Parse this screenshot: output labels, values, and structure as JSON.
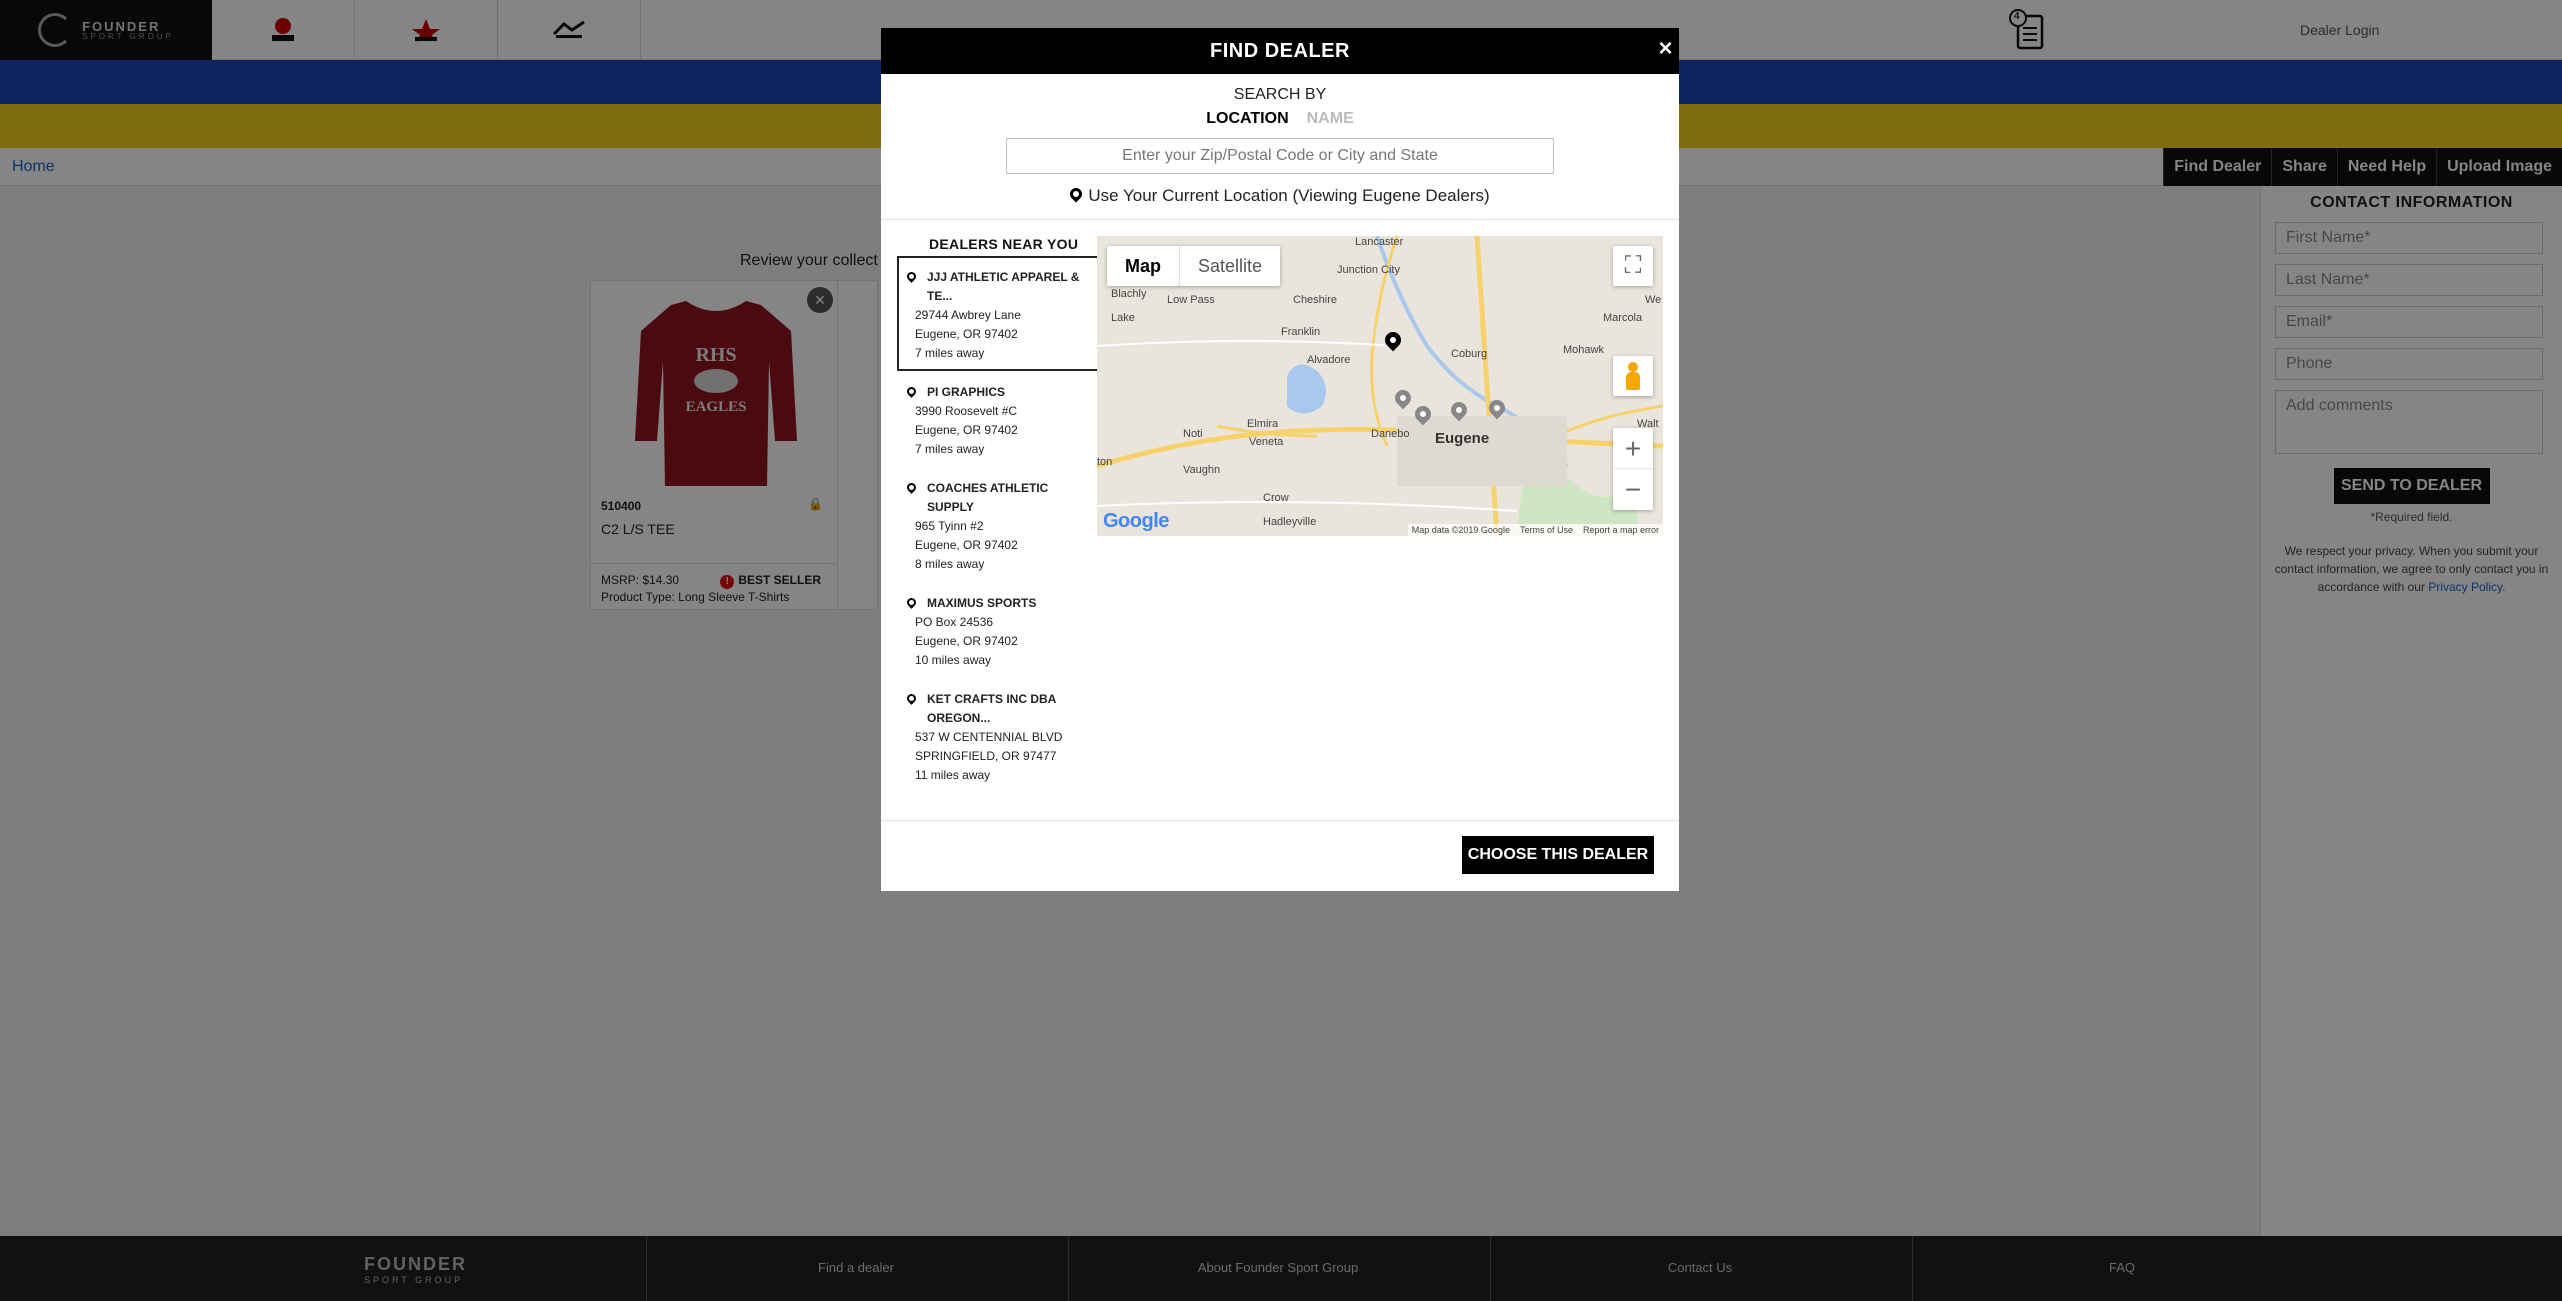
{
  "header": {
    "logo_text": "FOUNDER",
    "logo_sub": "SPORT GROUP",
    "brands": [
      {
        "name": "badger-logo"
      },
      {
        "name": "alleson-logo"
      },
      {
        "name": "garb-logo"
      }
    ],
    "cart_count": "4",
    "dealer_login": "Dealer Login"
  },
  "breadcrumb": {
    "home": "Home"
  },
  "actions": {
    "find_dealer": "Find Dealer",
    "share": "Share",
    "need_help": "Need Help",
    "upload_image": "Upload Image"
  },
  "contact": {
    "title": "CONTACT INFORMATION",
    "first_name": "First Name*",
    "last_name": "Last Name*",
    "email": "Email*",
    "phone": "Phone",
    "comments": "Add comments",
    "send": "SEND TO DEALER",
    "required": "*Required field.",
    "privacy_text": "We respect your privacy. When you submit your contact information, we agree to only contact you in accordance with our",
    "privacy_link": "Privacy Policy."
  },
  "collection": {
    "review_text": "Review your collect",
    "product": {
      "sku": "510400",
      "name": "C2 L/S TEE",
      "msrp": "MSRP: $14.30",
      "badge": "BEST SELLER",
      "type": "Product Type: Long Sleeve T-Shirts",
      "shirt_text_1": "RHS",
      "shirt_text_2": "EAGLES"
    }
  },
  "modal": {
    "title": "FIND DEALER",
    "close": "×",
    "search_by": "SEARCH BY",
    "tab_location": "LOCATION",
    "tab_name": "NAME",
    "search_placeholder": "Enter your Zip/Postal Code or City and State",
    "use_location": "Use Your Current Location (Viewing Eugene Dealers)",
    "dealers_title": "DEALERS NEAR YOU",
    "dealers": [
      {
        "name": "JJJ ATHLETIC APPAREL & TE...",
        "address": "29744 Awbrey Lane",
        "city": "Eugene, OR 97402",
        "distance": "7 miles away"
      },
      {
        "name": "PI GRAPHICS",
        "address": "3990 Roosevelt #C",
        "city": "Eugene, OR 97402",
        "distance": "7 miles away"
      },
      {
        "name": "COACHES ATHLETIC SUPPLY",
        "address": "965 Tyinn #2",
        "city": "Eugene, OR 97402",
        "distance": "8 miles away"
      },
      {
        "name": "MAXIMUS SPORTS",
        "address": "PO Box 24536",
        "city": "Eugene, OR 97402",
        "distance": "10 miles away"
      },
      {
        "name": "KET CRAFTS INC DBA OREGON...",
        "address": "537 W CENTENNIAL BLVD",
        "city": "SPRINGFIELD, OR 97477",
        "distance": "11 miles away"
      }
    ],
    "map": {
      "type_map": "Map",
      "type_satellite": "Satellite",
      "google": "Google",
      "attrib_data": "Map data ©2019 Google",
      "attrib_terms": "Terms of Use",
      "attrib_report": "Report a map error",
      "labels": [
        "Lancaster",
        "Junction City",
        "Blachly",
        "Low Pass",
        "Cheshire",
        "Franklin",
        "Alvadore",
        "Coburg",
        "Mohawk",
        "Marcola",
        "Lake",
        "Elmira",
        "Veneta",
        "Noti",
        "Danebo",
        "Eugene",
        "Vaughn",
        "Crow",
        "Hadleyville",
        "Walt",
        "We",
        "ton"
      ],
      "colors": {
        "land": "#e9e5dc",
        "water": "#a8c8ee",
        "park": "#cfe6c4",
        "highway": "#f7d26b",
        "pin_selected": "#000000",
        "pin_other": "#888888"
      }
    },
    "choose": "CHOOSE THIS DEALER"
  },
  "footer": {
    "logo": "FOUNDER",
    "logo_sub": "SPORT GROUP",
    "links": [
      "Find a dealer",
      "About Founder Sport Group",
      "Contact Us",
      "FAQ"
    ]
  }
}
